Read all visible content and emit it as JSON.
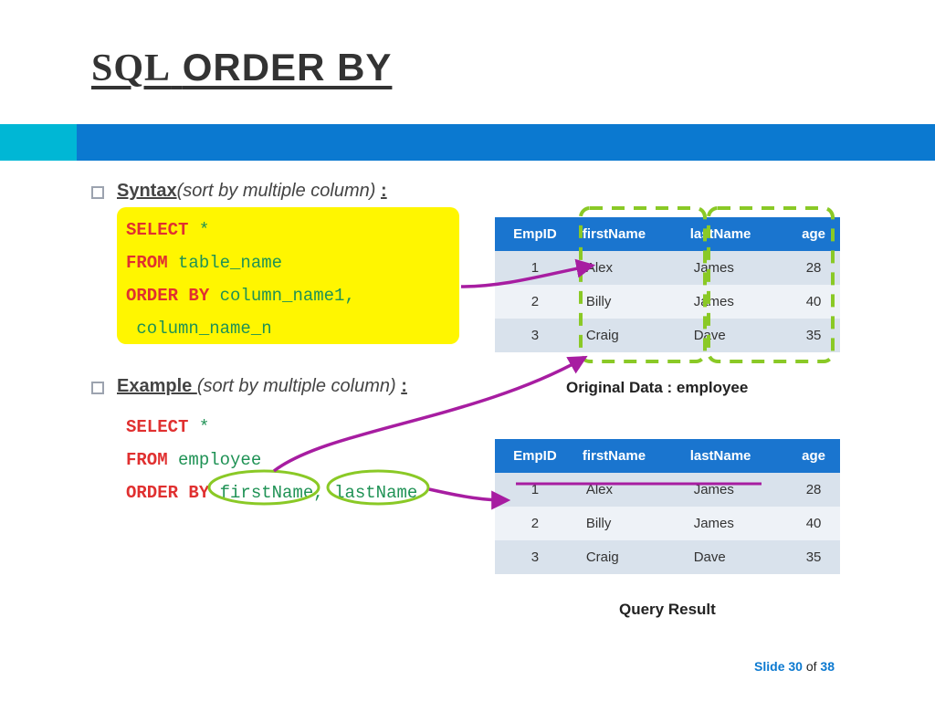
{
  "title": "SQL ORDER BY",
  "syntax": {
    "heading_bold": "Syntax",
    "heading_italic": "(sort by multiple column) ",
    "colon": ":",
    "line1_kw": "SELECT ",
    "line1_id": "*",
    "line2_kw": "FROM ",
    "line2_id": "table_name",
    "line3_kw": "ORDER BY ",
    "line3_id": "column_name1,",
    "line4_id": " column_name_n"
  },
  "example": {
    "heading_bold": "Example ",
    "heading_italic": "(sort by multiple column) ",
    "colon": ":",
    "line1_kw": "SELECT ",
    "line1_id": "*",
    "line2_kw": "FROM ",
    "line2_id": "employee",
    "line3_kw": "ORDER BY ",
    "line3_id1": "firstName",
    "line3_sep": ", ",
    "line3_id2": "lastName"
  },
  "tables": {
    "cols": [
      "EmpID",
      "firstName",
      "lastName",
      "age"
    ],
    "rows": [
      [
        "1",
        "Alex",
        "James",
        "28"
      ],
      [
        "2",
        "Billy",
        "James",
        "40"
      ],
      [
        "3",
        "Craig",
        "Dave",
        "35"
      ]
    ],
    "caption1": "Original Data : employee",
    "caption2": "Query Result"
  },
  "footer": {
    "slide": "Slide 30",
    "of": " of ",
    "total": "38"
  }
}
